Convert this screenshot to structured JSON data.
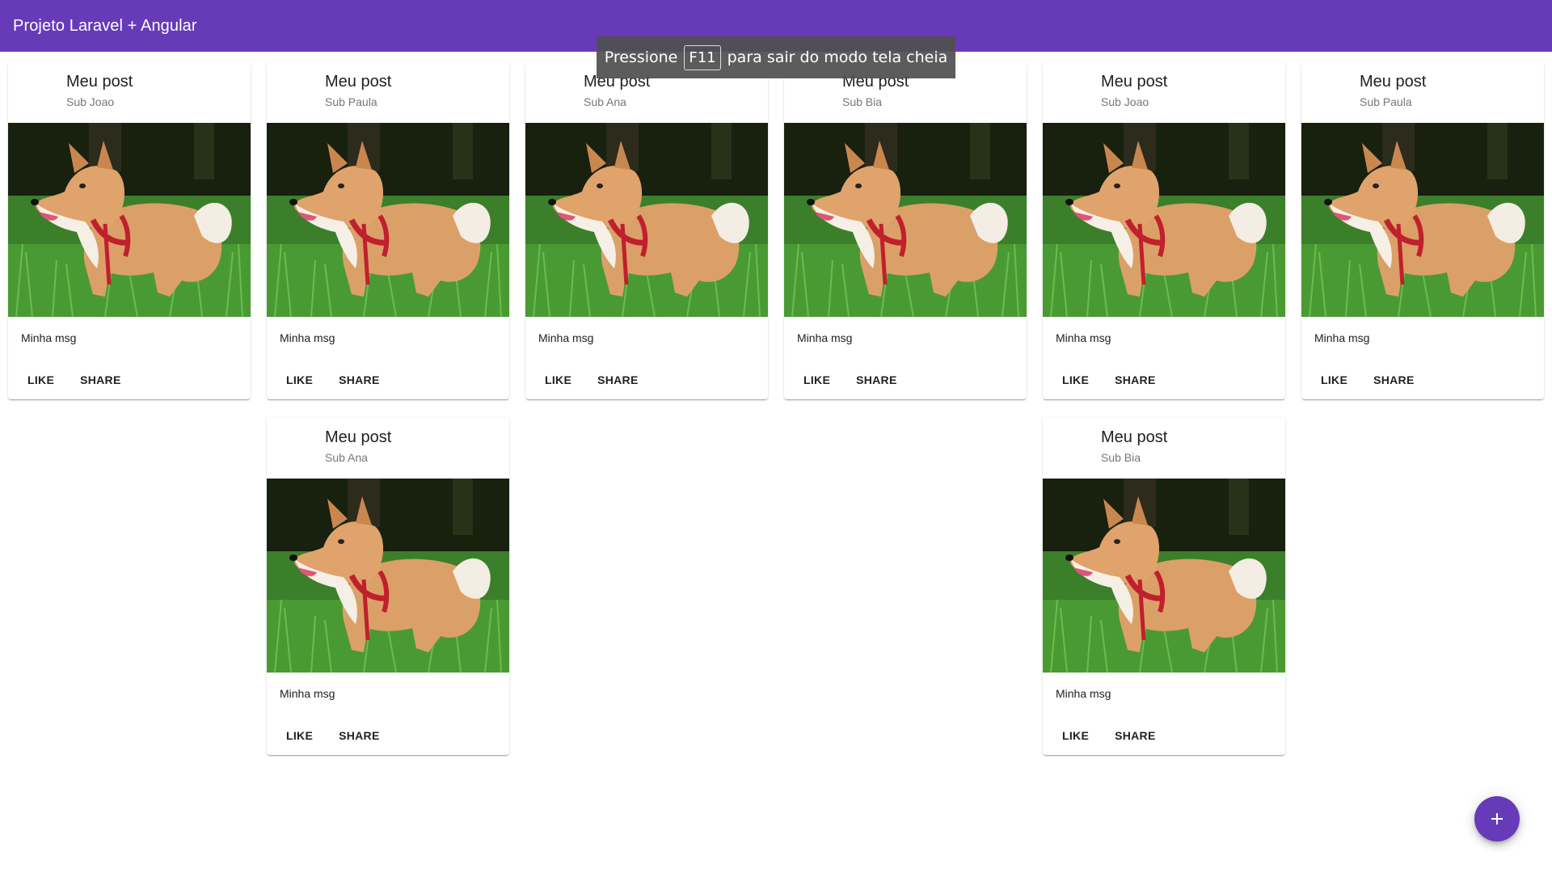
{
  "toolbar": {
    "title": "Projeto Laravel + Angular"
  },
  "fullscreen_notice": {
    "before": "Pressione",
    "key": "F11",
    "after": "para sair do modo tela cheia"
  },
  "posts": [
    {
      "title": "Meu post",
      "subtitle": "Sub Joao",
      "message": "Minha msg",
      "like_label": "LIKE",
      "share_label": "SHARE",
      "image": "shiba-inu-dog-photo"
    },
    {
      "title": "Meu post",
      "subtitle": "Sub Paula",
      "message": "Minha msg",
      "like_label": "LIKE",
      "share_label": "SHARE",
      "image": "shiba-inu-dog-photo"
    },
    {
      "title": "Meu post",
      "subtitle": "Sub Ana",
      "message": "Minha msg",
      "like_label": "LIKE",
      "share_label": "SHARE",
      "image": "shiba-inu-dog-photo"
    },
    {
      "title": "Meu post",
      "subtitle": "Sub Bia",
      "message": "Minha msg",
      "like_label": "LIKE",
      "share_label": "SHARE",
      "image": "shiba-inu-dog-photo"
    },
    {
      "title": "Meu post",
      "subtitle": "Sub Joao",
      "message": "Minha msg",
      "like_label": "LIKE",
      "share_label": "SHARE",
      "image": "shiba-inu-dog-photo"
    },
    {
      "title": "Meu post",
      "subtitle": "Sub Paula",
      "message": "Minha msg",
      "like_label": "LIKE",
      "share_label": "SHARE",
      "image": "shiba-inu-dog-photo"
    },
    {
      "title": "Meu post",
      "subtitle": "Sub Ana",
      "message": "Minha msg",
      "like_label": "LIKE",
      "share_label": "SHARE",
      "image": "shiba-inu-dog-photo"
    },
    {
      "title": "Meu post",
      "subtitle": "Sub Bia",
      "message": "Minha msg",
      "like_label": "LIKE",
      "share_label": "SHARE",
      "image": "shiba-inu-dog-photo"
    }
  ],
  "fab": {
    "icon": "add-icon"
  },
  "colors": {
    "primary": "#673ab7",
    "toast": "#505050",
    "grass": "#3f8a2e",
    "dog": "#d99a5c"
  }
}
